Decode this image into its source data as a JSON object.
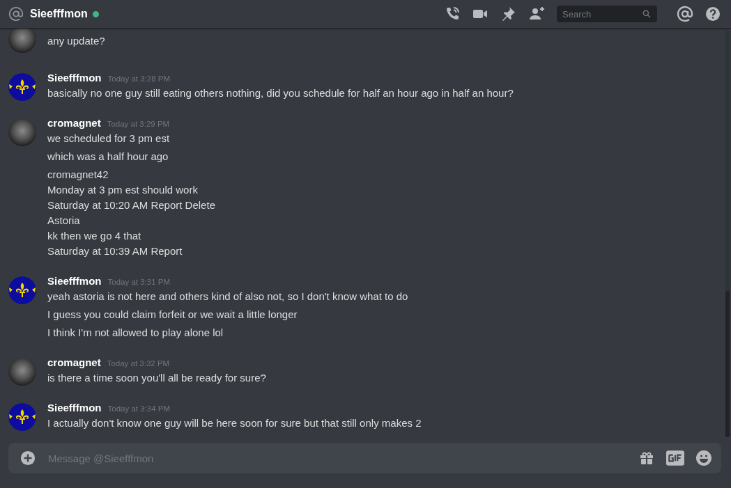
{
  "header": {
    "title": "Sieefffmon",
    "online": true,
    "search": {
      "placeholder": "Search"
    }
  },
  "groups": [
    {
      "kind": "photo",
      "messages": [
        {
          "lines": [
            "any update?"
          ]
        }
      ]
    },
    {
      "kind": "emblem",
      "author": "Sieefffmon",
      "time": "Today at 3:28 PM",
      "messages": [
        {
          "lines": [
            "basically no one guy still eating others nothing, did you schedule for half an hour ago in half an hour?"
          ]
        }
      ]
    },
    {
      "kind": "photo",
      "author": "cromagnet",
      "time": "Today at 3:29 PM",
      "messages": [
        {
          "lines": [
            "we scheduled for 3 pm est"
          ]
        },
        {
          "lines": [
            "which was a half hour ago"
          ]
        },
        {
          "lines": [
            "cromagnet42",
            "Monday at 3 pm est should work",
            "Saturday at 10:20 AM Report Delete",
            "Astoria",
            "kk then we go 4 that",
            "Saturday at 10:39 AM Report"
          ]
        }
      ]
    },
    {
      "kind": "emblem",
      "author": "Sieefffmon",
      "time": "Today at 3:31 PM",
      "messages": [
        {
          "lines": [
            "yeah astoria is not here and others kind of also not, so I don't know what to do"
          ]
        },
        {
          "lines": [
            "I guess you could claim forfeit or we wait a little longer"
          ]
        },
        {
          "lines": [
            "I think I'm not allowed to play alone lol"
          ]
        }
      ]
    },
    {
      "kind": "photo",
      "author": "cromagnet",
      "time": "Today at 3:32 PM",
      "messages": [
        {
          "lines": [
            "is there a time soon you'll all be ready for sure?"
          ]
        }
      ]
    },
    {
      "kind": "emblem",
      "author": "Sieefffmon",
      "time": "Today at 3:34 PM",
      "messages": [
        {
          "lines": [
            "I actually don't know one guy will be here soon for sure but that still only makes 2"
          ]
        }
      ]
    }
  ],
  "composer": {
    "placeholder": "Message @Sieefffmon"
  }
}
